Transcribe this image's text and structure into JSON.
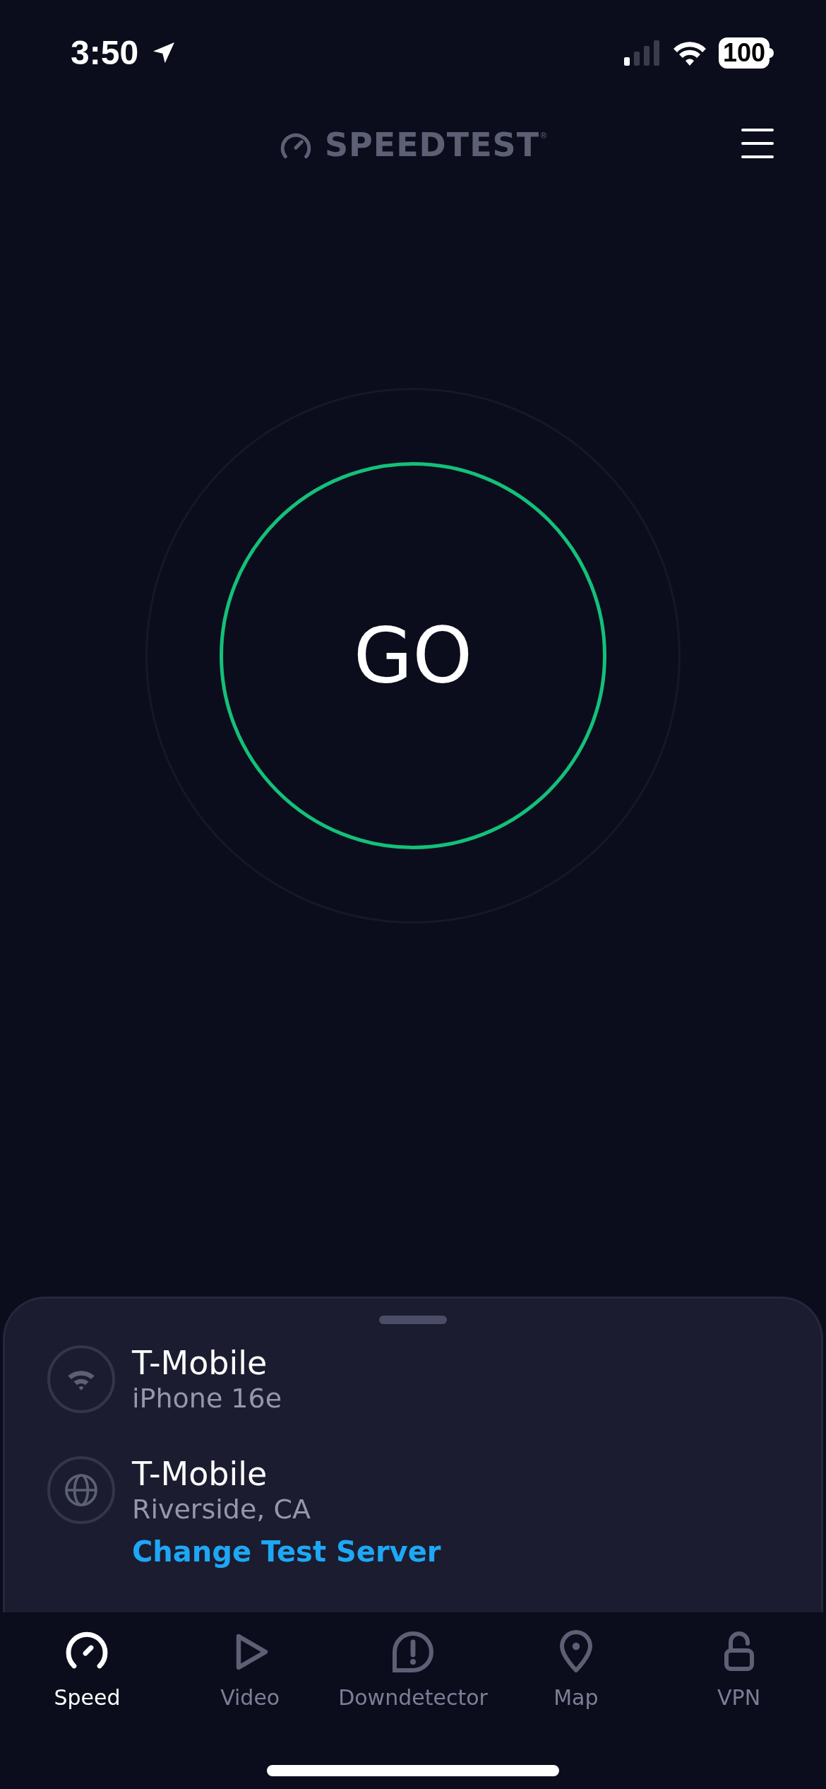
{
  "status_bar": {
    "time": "3:50",
    "battery": "100"
  },
  "header": {
    "logo": "SPEEDTEST",
    "logo_mark": "®"
  },
  "go_button": {
    "label": "GO"
  },
  "connection": {
    "items": [
      {
        "kind": "wifi",
        "title": "T-Mobile",
        "subtitle": "iPhone 16e"
      },
      {
        "kind": "globe",
        "title": "T-Mobile",
        "subtitle": "Riverside, CA"
      }
    ],
    "link": "Change Test Server"
  },
  "tabs": [
    {
      "kind": "speed",
      "label": "Speed",
      "selected": true
    },
    {
      "kind": "video",
      "label": "Video",
      "selected": false
    },
    {
      "kind": "alert",
      "label": "Downdetector",
      "selected": false
    },
    {
      "kind": "map",
      "label": "Map",
      "selected": false
    },
    {
      "kind": "vpn",
      "label": "VPN",
      "selected": false
    }
  ]
}
